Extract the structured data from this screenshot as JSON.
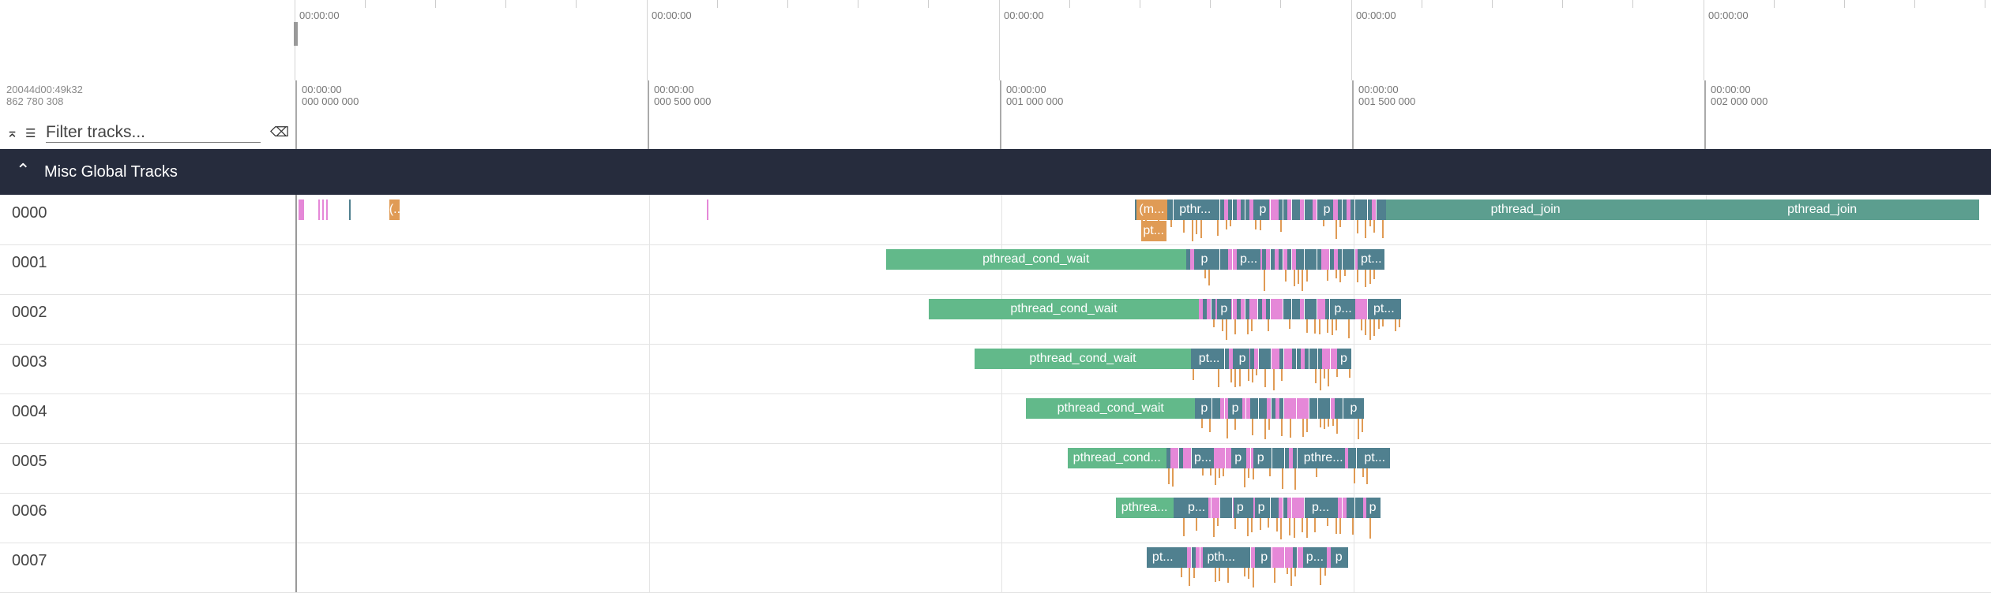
{
  "overview": {
    "tick_labels": [
      "00:00:00",
      "00:00:00",
      "00:00:00",
      "00:00:00",
      "00:00:00"
    ]
  },
  "header": {
    "timestamp_line1": "20044d00:49k32",
    "timestamp_line2": "862 780 308",
    "filter_placeholder": "Filter tracks...",
    "collapse_icon": "collapse-all-icon",
    "filter_icon": "filter-list-icon",
    "clear_icon": "clear-filter-icon"
  },
  "ruler": {
    "ticks": [
      {
        "time": "00:00:00",
        "ns": "000 000 000"
      },
      {
        "time": "00:00:00",
        "ns": "000 500 000"
      },
      {
        "time": "00:00:00",
        "ns": "001 000 000"
      },
      {
        "time": "00:00:00",
        "ns": "001 500 000"
      },
      {
        "time": "00:00:00",
        "ns": "002 000 000"
      }
    ]
  },
  "group": {
    "title": "Misc Global Tracks",
    "chevron_icon": "chevron-up-icon"
  },
  "colors": {
    "teal": "#50808f",
    "green": "#62b98a",
    "pink": "#e588d8",
    "orange": "#e09b55",
    "jade": "#5c9e8f",
    "group_bg": "#262c3d"
  },
  "tracks": [
    {
      "name": "0000",
      "slices": [
        {
          "label": "(...",
          "s": 0.131,
          "w": 0.015,
          "c": "orange"
        },
        {
          "label": "(m...",
          "s": 1.192,
          "w": 0.043,
          "c": "orange"
        },
        {
          "label": "pthr...",
          "s": 1.244,
          "w": 0.062,
          "c": "teal"
        },
        {
          "label": "p",
          "s": 1.362,
          "w": 0.018,
          "c": "teal"
        },
        {
          "label": "p",
          "s": 1.453,
          "w": 0.018,
          "c": "teal"
        },
        {
          "label": "pthread_join",
          "s": 1.546,
          "w": 0.396,
          "c": "jade"
        },
        {
          "label": "pthread_join",
          "s": 1.942,
          "w": 0.446,
          "c": "jade"
        },
        {
          "label": "pt...",
          "s": 1.198,
          "w": 0.036,
          "c": "orange",
          "row": 2
        }
      ]
    },
    {
      "name": "0001",
      "slices": [
        {
          "label": "pthread_cond_wait",
          "s": 0.836,
          "w": 0.426,
          "c": "green"
        },
        {
          "label": "p",
          "s": 1.276,
          "w": 0.024,
          "c": "teal"
        },
        {
          "label": "p...",
          "s": 1.334,
          "w": 0.034,
          "c": "teal"
        },
        {
          "label": "pt...",
          "s": 1.506,
          "w": 0.038,
          "c": "teal"
        }
      ]
    },
    {
      "name": "0002",
      "slices": [
        {
          "label": "pthread_cond_wait",
          "s": 0.897,
          "w": 0.383,
          "c": "green"
        },
        {
          "label": "p",
          "s": 1.306,
          "w": 0.02,
          "c": "teal"
        },
        {
          "label": "p...",
          "s": 1.468,
          "w": 0.034,
          "c": "teal"
        },
        {
          "label": "pt...",
          "s": 1.523,
          "w": 0.04,
          "c": "teal"
        }
      ]
    },
    {
      "name": "0003",
      "slices": [
        {
          "label": "pthread_cond_wait",
          "s": 0.962,
          "w": 0.307,
          "c": "green"
        },
        {
          "label": "pt...",
          "s": 1.276,
          "w": 0.038,
          "c": "teal"
        },
        {
          "label": "p",
          "s": 1.332,
          "w": 0.02,
          "c": "teal"
        },
        {
          "label": "p",
          "s": 1.476,
          "w": 0.02,
          "c": "teal"
        }
      ]
    },
    {
      "name": "0004",
      "slices": [
        {
          "label": "pthread_cond_wait",
          "s": 1.035,
          "w": 0.24,
          "c": "green"
        },
        {
          "label": "p",
          "s": 1.278,
          "w": 0.02,
          "c": "teal"
        },
        {
          "label": "p",
          "s": 1.322,
          "w": 0.02,
          "c": "teal"
        },
        {
          "label": "p",
          "s": 1.49,
          "w": 0.02,
          "c": "teal"
        }
      ]
    },
    {
      "name": "0005",
      "slices": [
        {
          "label": "pthread_cond...",
          "s": 1.094,
          "w": 0.14,
          "c": "green"
        },
        {
          "label": "p...",
          "s": 1.27,
          "w": 0.032,
          "c": "teal"
        },
        {
          "label": "p",
          "s": 1.326,
          "w": 0.02,
          "c": "teal"
        },
        {
          "label": "p",
          "s": 1.358,
          "w": 0.02,
          "c": "teal"
        },
        {
          "label": "pthre...",
          "s": 1.426,
          "w": 0.062,
          "c": "teal"
        },
        {
          "label": "pt...",
          "s": 1.508,
          "w": 0.044,
          "c": "teal"
        }
      ]
    },
    {
      "name": "0006",
      "slices": [
        {
          "label": "pthrea...",
          "s": 1.162,
          "w": 0.082,
          "c": "green"
        },
        {
          "label": "p...",
          "s": 1.26,
          "w": 0.034,
          "c": "teal"
        },
        {
          "label": "p",
          "s": 1.33,
          "w": 0.018,
          "c": "teal"
        },
        {
          "label": "p",
          "s": 1.36,
          "w": 0.018,
          "c": "teal"
        },
        {
          "label": "p...",
          "s": 1.436,
          "w": 0.034,
          "c": "teal"
        },
        {
          "label": "p",
          "s": 1.518,
          "w": 0.018,
          "c": "teal"
        }
      ]
    },
    {
      "name": "0007",
      "slices": [
        {
          "label": "pt...",
          "s": 1.206,
          "w": 0.046,
          "c": "teal"
        },
        {
          "label": "pth...",
          "s": 1.286,
          "w": 0.052,
          "c": "teal"
        },
        {
          "label": "p",
          "s": 1.364,
          "w": 0.018,
          "c": "teal"
        },
        {
          "label": "p...",
          "s": 1.428,
          "w": 0.034,
          "c": "teal"
        },
        {
          "label": "p",
          "s": 1.47,
          "w": 0.018,
          "c": "teal"
        }
      ]
    }
  ]
}
